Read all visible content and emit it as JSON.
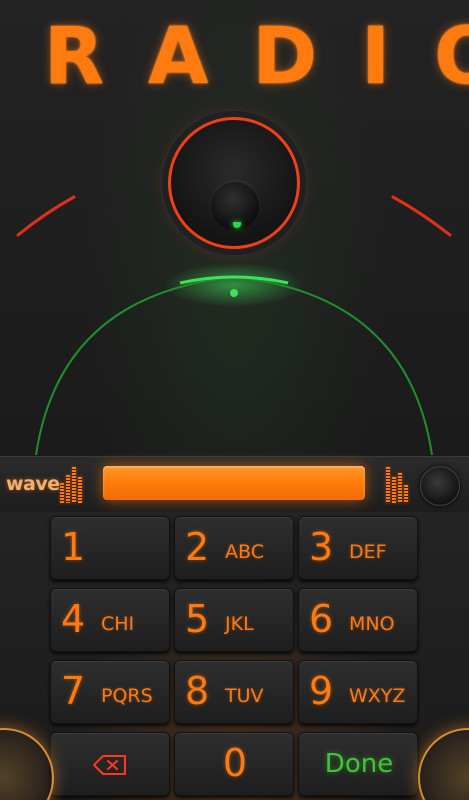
{
  "app": {
    "title": "RADIO"
  },
  "colors": {
    "accent": "#ff7a10",
    "needle": "#f04015",
    "tuner_arc": "#1f8f2c",
    "done": "#43c33a",
    "background": "#1d1d1d"
  },
  "display": {
    "brand": "wave",
    "number_value": ""
  },
  "keypad": {
    "keys": [
      {
        "digit": "1",
        "letters": ""
      },
      {
        "digit": "2",
        "letters": "ABC"
      },
      {
        "digit": "3",
        "letters": "DEF"
      },
      {
        "digit": "4",
        "letters": "CHI"
      },
      {
        "digit": "5",
        "letters": "JKL"
      },
      {
        "digit": "6",
        "letters": "MNO"
      },
      {
        "digit": "7",
        "letters": "PQRS"
      },
      {
        "digit": "8",
        "letters": "TUV"
      },
      {
        "digit": "9",
        "letters": "WXYZ"
      },
      {
        "digit": "0",
        "letters": ""
      }
    ],
    "backspace_icon": "backspace-icon",
    "done_label": "Done"
  }
}
